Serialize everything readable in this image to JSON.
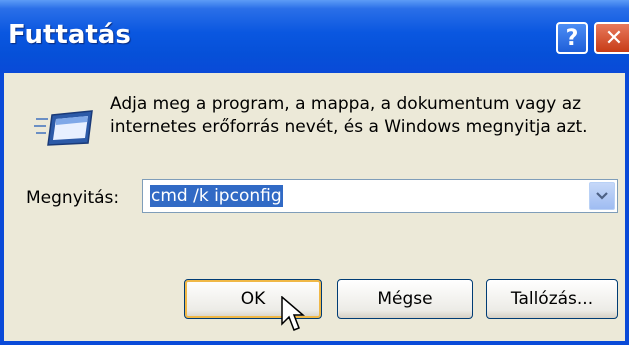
{
  "window": {
    "title": "Futtatás",
    "help_label": "?",
    "close_label": "✕"
  },
  "dialog": {
    "description": "Adja meg a program, a mappa, a dokumentum vagy az internetes erőforrás nevét, és a Windows megnyitja azt.",
    "open_label": "Megnyitás:",
    "open_value": "cmd /k ipconfig"
  },
  "buttons": {
    "ok": "OK",
    "cancel": "Mégse",
    "browse": "Tallózás..."
  },
  "icons": [
    "run-dialog-icon",
    "chevron-down-icon",
    "mouse-pointer-icon"
  ],
  "colors": {
    "titlebar": "#0a57e0",
    "selection": "#316ac5",
    "face": "#ece9d8"
  }
}
